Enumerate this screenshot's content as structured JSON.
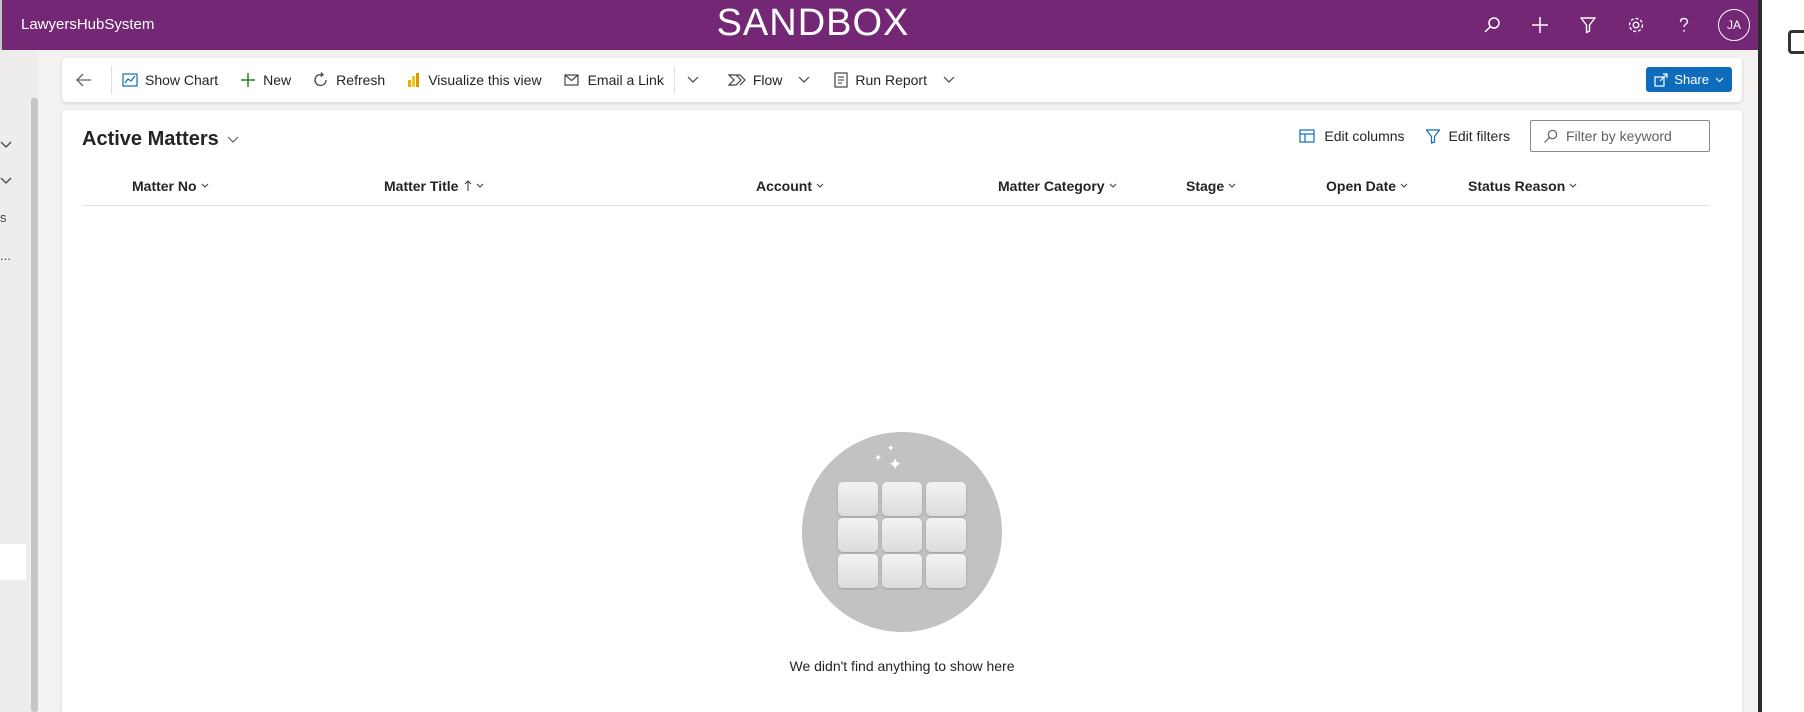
{
  "header": {
    "app_name": "LawyersHubSystem",
    "environment": "SANDBOX",
    "avatar_initials": "JA",
    "bar_color": "#742774"
  },
  "command_bar": {
    "show_chart": "Show Chart",
    "new": "New",
    "refresh": "Refresh",
    "visualize": "Visualize this view",
    "email_link": "Email a Link",
    "flow": "Flow",
    "run_report": "Run Report",
    "share": "Share"
  },
  "view": {
    "title": "Active Matters",
    "edit_columns": "Edit columns",
    "edit_filters": "Edit filters",
    "filter_placeholder": "Filter by keyword"
  },
  "columns": [
    {
      "label": "Matter No",
      "sorted": false
    },
    {
      "label": "Matter Title",
      "sorted": true
    },
    {
      "label": "Account",
      "sorted": false
    },
    {
      "label": "Matter Category",
      "sorted": false
    },
    {
      "label": "Stage",
      "sorted": false
    },
    {
      "label": "Open Date",
      "sorted": false
    },
    {
      "label": "Status Reason",
      "sorted": false
    }
  ],
  "empty_state": {
    "message": "We didn't find anything to show here"
  },
  "sidebar": {
    "marks": [
      "s",
      "..."
    ]
  },
  "colors": {
    "accent_blue": "#0f6cbd",
    "new_icon_green": "#107c10"
  }
}
